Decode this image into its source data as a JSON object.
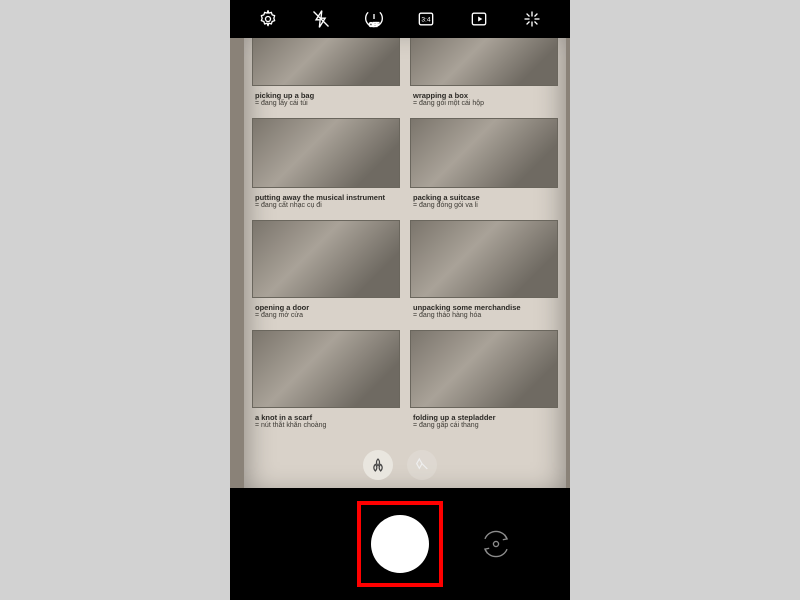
{
  "toolbar": {
    "timer_label": "OFF",
    "ratio_label": "3:4"
  },
  "page_items": {
    "left": [
      {
        "title": "picking up a bag",
        "sub": "= đang lấy cái túi"
      },
      {
        "title": "putting away the musical instrument",
        "sub": "= đang cất nhạc cụ đi"
      },
      {
        "title": "opening a door",
        "sub": "= đang mở cửa"
      },
      {
        "title": "a knot in a scarf",
        "sub": "= nút thắt khăn choàng"
      }
    ],
    "right": [
      {
        "title": "wrapping a box",
        "sub": "= đang gói một cái hộp"
      },
      {
        "title": "packing a suitcase",
        "sub": "= đang đóng gói va li"
      },
      {
        "title": "unpacking some merchandise",
        "sub": "= đang tháo hàng hóa"
      },
      {
        "title": "folding up a stepladder",
        "sub": "= đang gấp cái thang"
      }
    ]
  }
}
